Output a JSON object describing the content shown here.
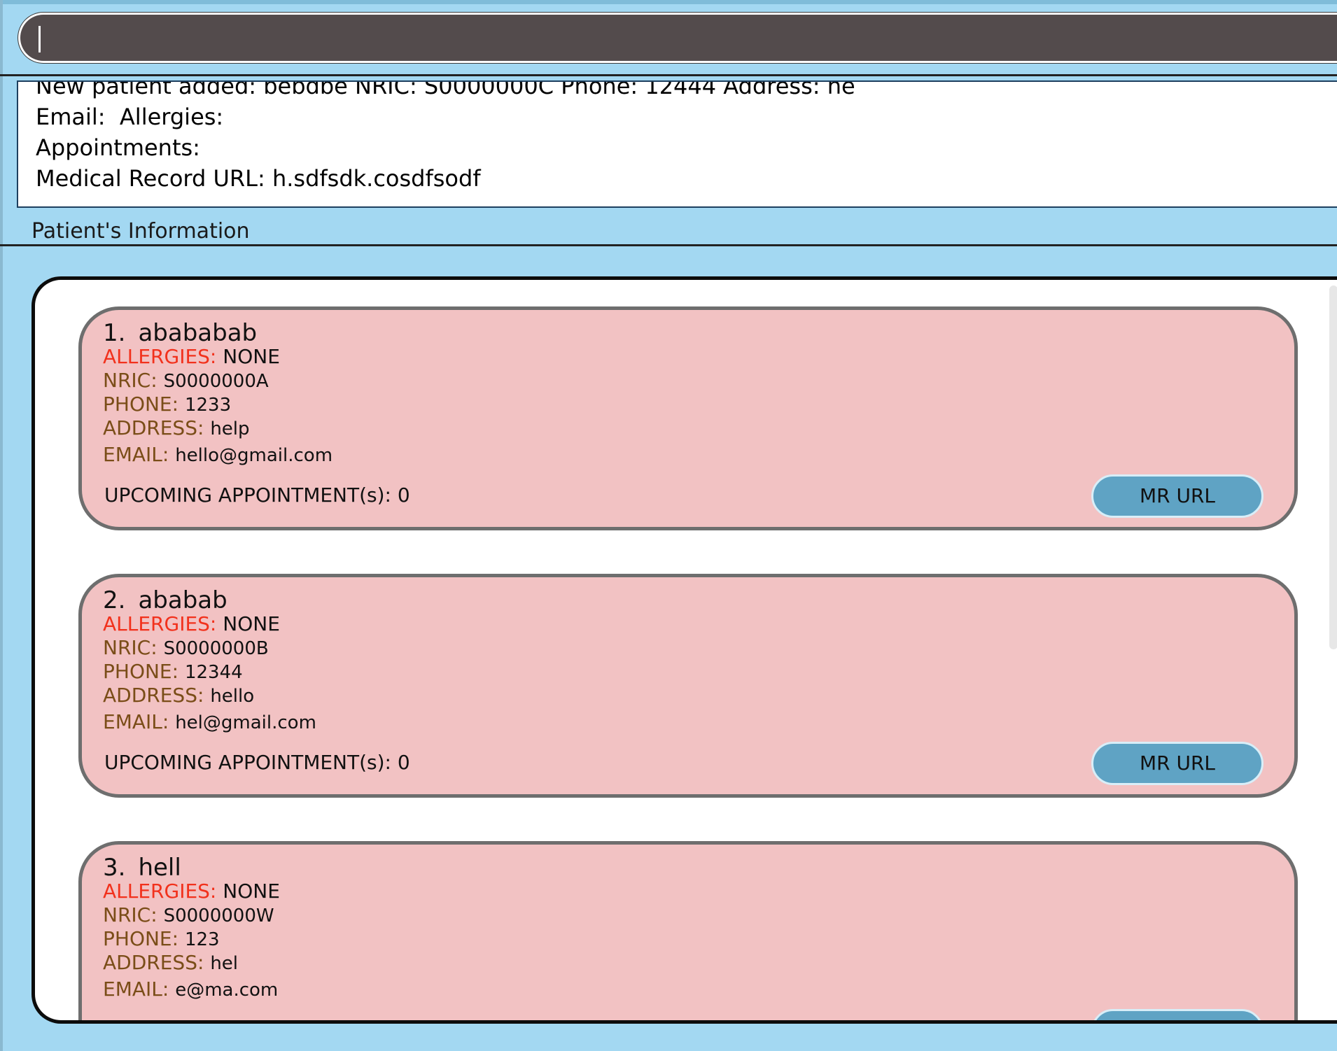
{
  "command_box": {
    "value": ""
  },
  "result_display": {
    "text": "New patient added: bebdbe NRIC: S0000000C Phone: 12444 Address: he\nEmail:  Allergies: \nAppointments: \nMedical Record URL: h.sdfsdk.cosdfsodf"
  },
  "panel_title": "Patient's Information",
  "labels": {
    "allergies": "ALLERGIES:",
    "nric": "NRIC:",
    "phone": "PHONE:",
    "address": "ADDRESS:",
    "email": "EMAIL:",
    "appointments": "UPCOMING APPOINTMENT(s): 0",
    "mr_button": "MR URL"
  },
  "patients": [
    {
      "index": "1.",
      "name": "abababab",
      "allergies": "NONE",
      "nric": "S0000000A",
      "phone": "1233",
      "address": "help",
      "email": "hello@gmail.com"
    },
    {
      "index": "2.",
      "name": "ababab",
      "allergies": "NONE",
      "nric": "S0000000B",
      "phone": "12344",
      "address": "hello",
      "email": "hel@gmail.com"
    },
    {
      "index": "3.",
      "name": "hell",
      "allergies": "NONE",
      "nric": "S0000000W",
      "phone": "123",
      "address": "hel",
      "email": "e@ma.com"
    }
  ]
}
